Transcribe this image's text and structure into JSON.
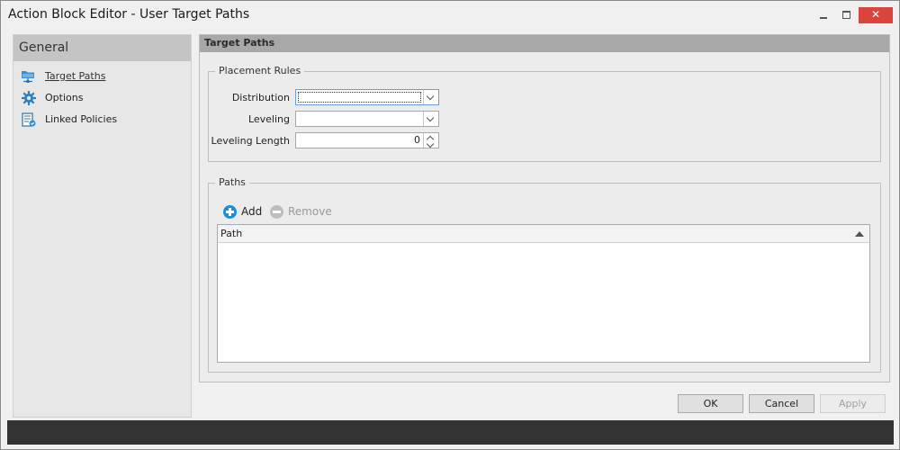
{
  "window": {
    "title": "Action Block Editor - User Target Paths",
    "close_glyph": "✕"
  },
  "sidebar": {
    "header": "General",
    "items": [
      {
        "label": "Target Paths",
        "icon": "folder-network-icon",
        "active": true
      },
      {
        "label": "Options",
        "icon": "gear-icon",
        "active": false
      },
      {
        "label": "Linked Policies",
        "icon": "policy-document-icon",
        "active": false
      }
    ]
  },
  "main": {
    "header": "Target Paths",
    "placement_rules": {
      "legend": "Placement Rules",
      "distribution_label": "Distribution",
      "distribution_value": "",
      "leveling_label": "Leveling",
      "leveling_value": "",
      "leveling_length_label": "Leveling Length",
      "leveling_length_value": "0"
    },
    "paths": {
      "legend": "Paths",
      "add_label": "Add",
      "remove_label": "Remove",
      "columns": [
        "Path"
      ],
      "rows": []
    }
  },
  "footer": {
    "ok_label": "OK",
    "cancel_label": "Cancel",
    "apply_label": "Apply"
  },
  "colors": {
    "accent": "#1c8dd6",
    "close": "#d9453d",
    "statusbar": "#333333"
  }
}
